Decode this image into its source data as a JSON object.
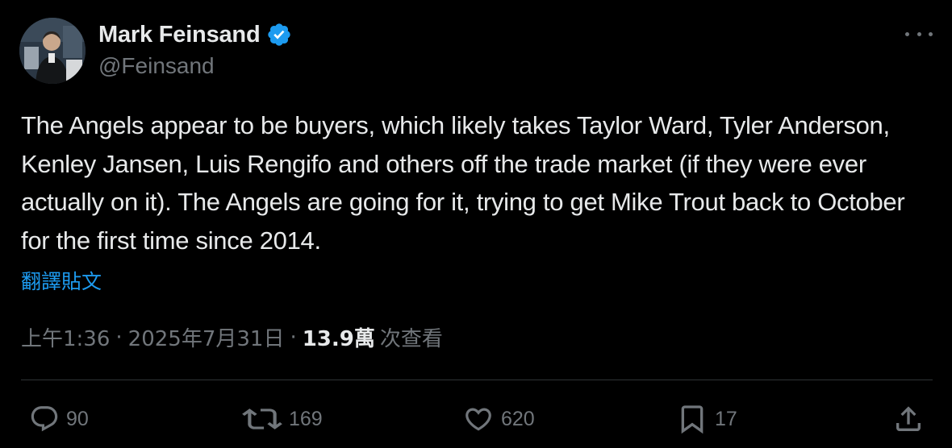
{
  "author": {
    "display_name": "Mark Feinsand",
    "handle": "@Feinsand",
    "verified": true
  },
  "tweet": {
    "text": "The Angels appear to be buyers, which likely takes Taylor Ward, Tyler Anderson, Kenley Jansen, Luis Rengifo and others off the trade market (if they were ever actually on it). The Angels are going for it, trying to get Mike Trout back to October for the first time since 2014.",
    "translate_label": "翻譯貼文",
    "time": "上午1:36",
    "date": "2025年7月31日",
    "separator": "·",
    "views_count": "13.9萬",
    "views_label": "次查看"
  },
  "actions": {
    "replies": "90",
    "retweets": "169",
    "likes": "620",
    "bookmarks": "17"
  },
  "icons": {
    "more": "more-horizontal-icon",
    "verified": "verified-badge-icon",
    "reply": "reply-icon",
    "retweet": "retweet-icon",
    "like": "heart-icon",
    "bookmark": "bookmark-icon",
    "share": "share-icon"
  },
  "colors": {
    "background": "#000000",
    "text": "#e7e9ea",
    "secondary": "#71767b",
    "accent": "#1d9bf0",
    "divider": "#2f3336"
  }
}
